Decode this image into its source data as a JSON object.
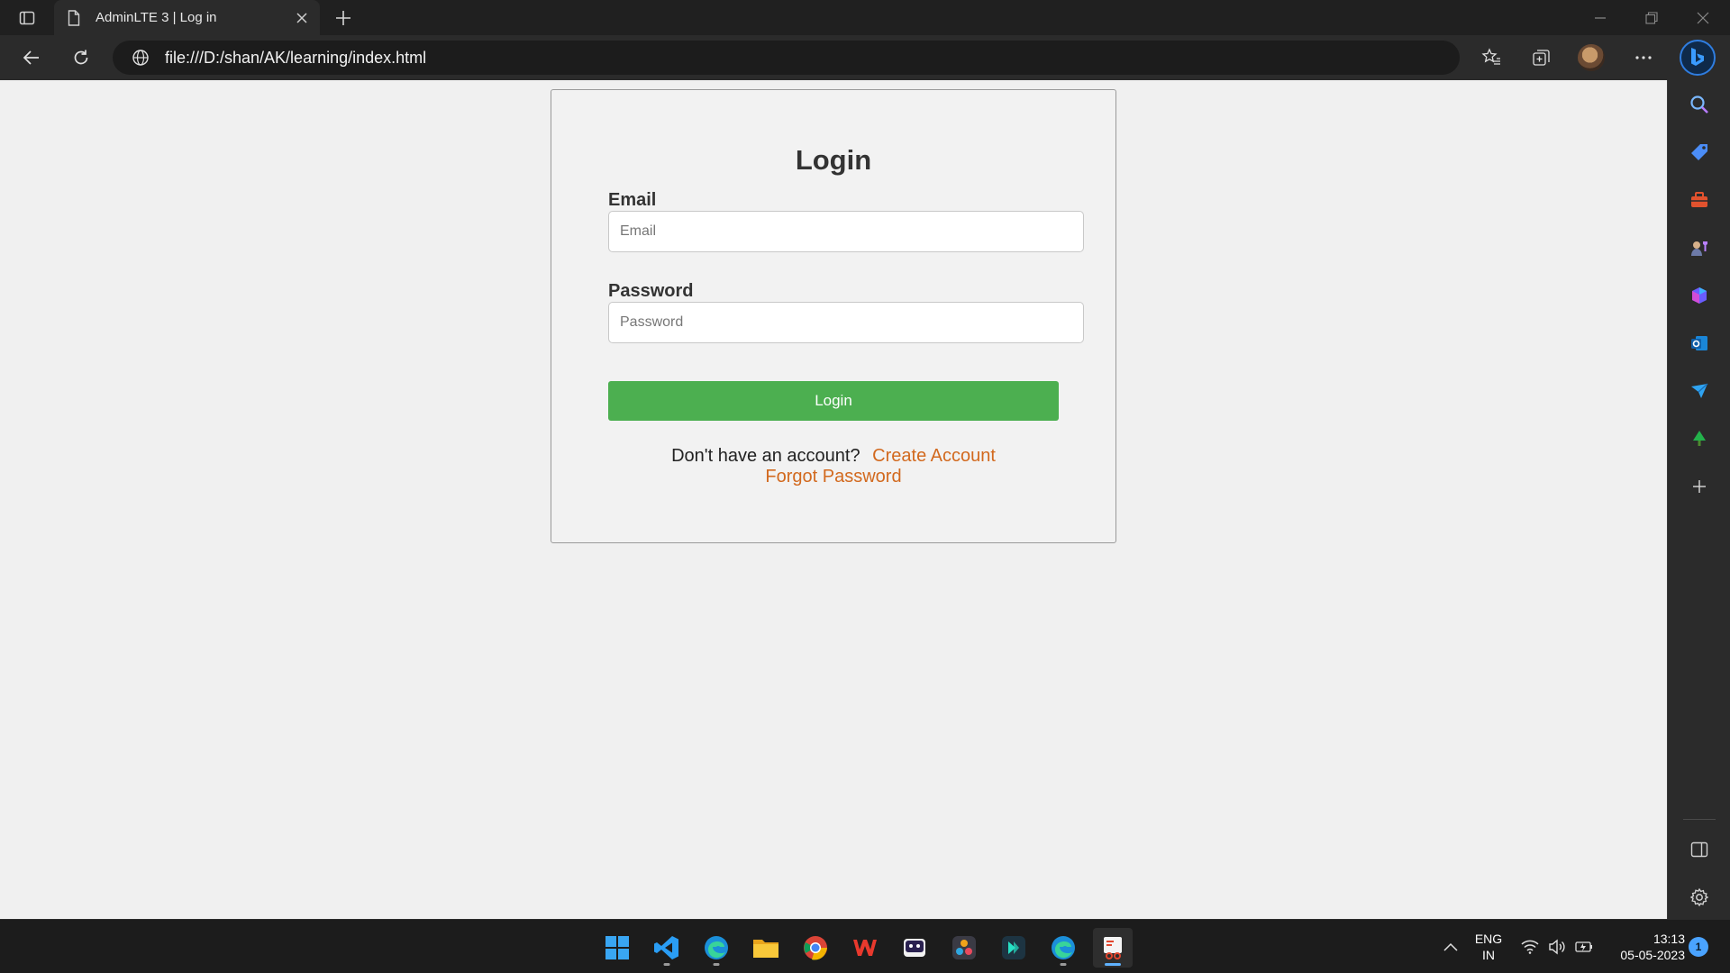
{
  "browser": {
    "tab": {
      "title": "AdminLTE 3 | Log in"
    },
    "address": {
      "url": "file:///D:/shan/AK/learning/index.html"
    },
    "sidebar_icons": [
      "search-icon",
      "tag-icon",
      "toolbox-icon",
      "games-icon",
      "office-icon",
      "outlook-icon",
      "send-icon",
      "tree-icon",
      "add-icon",
      "split-pane-icon",
      "settings-icon"
    ]
  },
  "login": {
    "title": "Login",
    "email": {
      "label": "Email",
      "placeholder": "Email",
      "value": ""
    },
    "password": {
      "label": "Password",
      "placeholder": "Password",
      "value": ""
    },
    "button_label": "Login",
    "prompt_text": "Don't have an account?",
    "create_account_link": "Create Account",
    "forgot_password_link": "Forgot Password"
  },
  "taskbar": {
    "apps": [
      "windows-start",
      "vscode",
      "edge",
      "file-explorer",
      "chrome",
      "wps-office",
      "media-app",
      "davinci-resolve",
      "filmora",
      "edge-beta",
      "snipping-tool"
    ],
    "language": {
      "line1": "ENG",
      "line2": "IN"
    },
    "clock": {
      "time": "13:13",
      "date": "05-05-2023"
    },
    "notification_count": "1"
  },
  "colors": {
    "login_button": "#4caf50",
    "link": "#d2691e",
    "browser_chrome": "#2b2b2b",
    "taskbar": "#1c1c1c"
  }
}
